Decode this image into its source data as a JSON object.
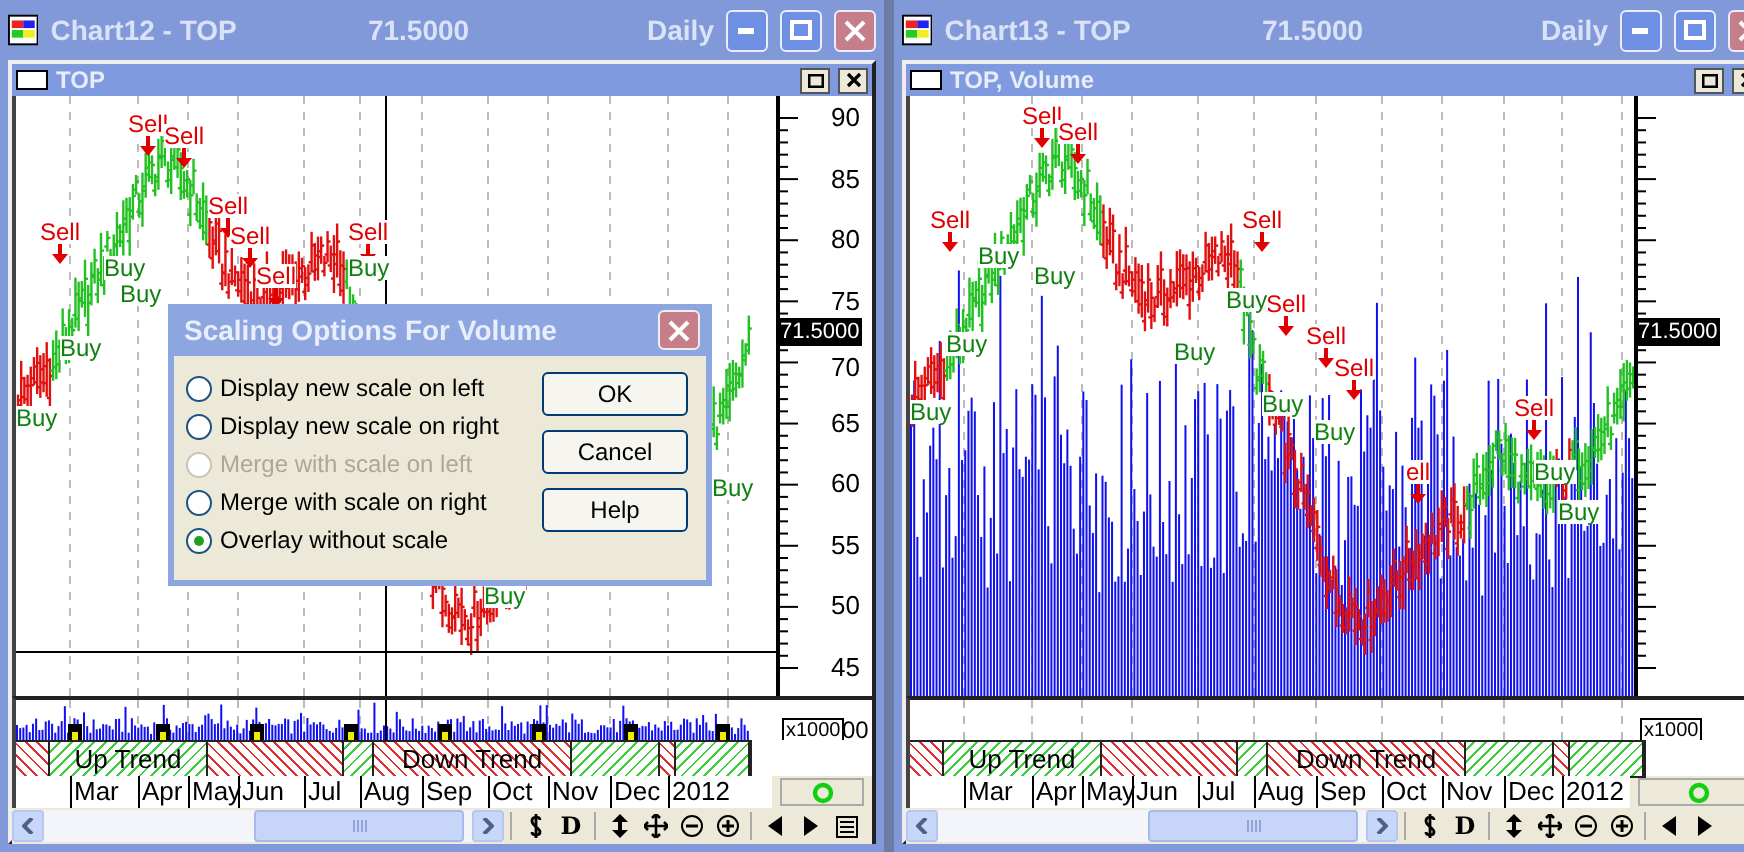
{
  "windows": [
    {
      "title": "Chart12 - TOP",
      "price": "71.5000",
      "period": "Daily",
      "pane_title": "TOP",
      "volume_overlay": false,
      "crosshair": true,
      "y_axis": [
        "90",
        "85",
        "80",
        "75",
        "70",
        "65",
        "60",
        "55",
        "50",
        "45"
      ],
      "last_price": "71.5000",
      "volume_unit": "x1000",
      "volume_axis": "00",
      "signals": [
        {
          "kind": "sell",
          "label": "Sell"
        },
        {
          "kind": "sell",
          "label": "Sell"
        },
        {
          "kind": "sell",
          "label": "Sell"
        },
        {
          "kind": "sell",
          "label": "Sell"
        },
        {
          "kind": "sell",
          "label": "Sell"
        },
        {
          "kind": "sell",
          "label": "Sell"
        },
        {
          "kind": "sell",
          "label": "Sell"
        },
        {
          "kind": "buy",
          "label": "Buy"
        },
        {
          "kind": "buy",
          "label": "Buy"
        },
        {
          "kind": "buy",
          "label": "Buy"
        },
        {
          "kind": "buy",
          "label": "Buy"
        },
        {
          "kind": "buy",
          "label": "Buy"
        },
        {
          "kind": "buy",
          "label": "Buy"
        },
        {
          "kind": "buy",
          "label": "Buy"
        }
      ],
      "trend_segments": [
        {
          "kind": "down"
        },
        {
          "kind": "up",
          "label": "Up Trend"
        },
        {
          "kind": "down"
        },
        {
          "kind": "up"
        },
        {
          "kind": "down",
          "label": "Down Trend"
        },
        {
          "kind": "up"
        },
        {
          "kind": "down"
        },
        {
          "kind": "up"
        }
      ],
      "months": [
        "Mar",
        "Apr",
        "May",
        "Jun",
        "Jul",
        "Aug",
        "Sep",
        "Oct",
        "Nov",
        "Dec",
        "2012"
      ],
      "period_button": "D"
    },
    {
      "title": "Chart13 - TOP",
      "price": "71.5000",
      "period": "Daily",
      "pane_title": "TOP, Volume",
      "volume_overlay": true,
      "crosshair": false,
      "last_price": "71.5000",
      "volume_unit": "x1000",
      "signals": [
        {
          "kind": "sell",
          "label": "Sell"
        },
        {
          "kind": "sell",
          "label": "Sell"
        },
        {
          "kind": "sell",
          "label": "Sell"
        },
        {
          "kind": "sell",
          "label": "Sell"
        },
        {
          "kind": "sell",
          "label": "Sell"
        },
        {
          "kind": "sell",
          "label": "Sell"
        },
        {
          "kind": "sell",
          "label": "Sell"
        },
        {
          "kind": "sell",
          "label": "Sell"
        },
        {
          "kind": "sell",
          "label": "ell"
        },
        {
          "kind": "buy",
          "label": "Buy"
        },
        {
          "kind": "buy",
          "label": "Buy"
        },
        {
          "kind": "buy",
          "label": "Buy"
        },
        {
          "kind": "buy",
          "label": "Buy"
        },
        {
          "kind": "buy",
          "label": "Buy"
        },
        {
          "kind": "buy",
          "label": "Buy"
        },
        {
          "kind": "buy",
          "label": "Buy"
        },
        {
          "kind": "buy",
          "label": "Buy"
        },
        {
          "kind": "buy",
          "label": "Buy"
        },
        {
          "kind": "buy",
          "label": "Buy"
        }
      ],
      "trend_segments": [
        {
          "kind": "down"
        },
        {
          "kind": "up",
          "label": "Up Trend"
        },
        {
          "kind": "down"
        },
        {
          "kind": "up"
        },
        {
          "kind": "down",
          "label": "Down Trend"
        },
        {
          "kind": "up"
        },
        {
          "kind": "down"
        },
        {
          "kind": "up"
        }
      ],
      "months": [
        "Mar",
        "Apr",
        "May",
        "Jun",
        "Jul",
        "Aug",
        "Sep",
        "Oct",
        "Nov",
        "Dec",
        "2012"
      ],
      "period_button": "D"
    }
  ],
  "dialog": {
    "title": "Scaling Options For Volume",
    "options": [
      {
        "label": "Display new scale on left",
        "selected": false,
        "disabled": false
      },
      {
        "label": "Display new scale on right",
        "selected": false,
        "disabled": false
      },
      {
        "label": "Merge with scale on left",
        "selected": false,
        "disabled": true
      },
      {
        "label": "Merge with scale on right",
        "selected": false,
        "disabled": false
      },
      {
        "label": "Overlay without scale",
        "selected": true,
        "disabled": false
      }
    ],
    "buttons": [
      "OK",
      "Cancel",
      "Help"
    ]
  }
}
